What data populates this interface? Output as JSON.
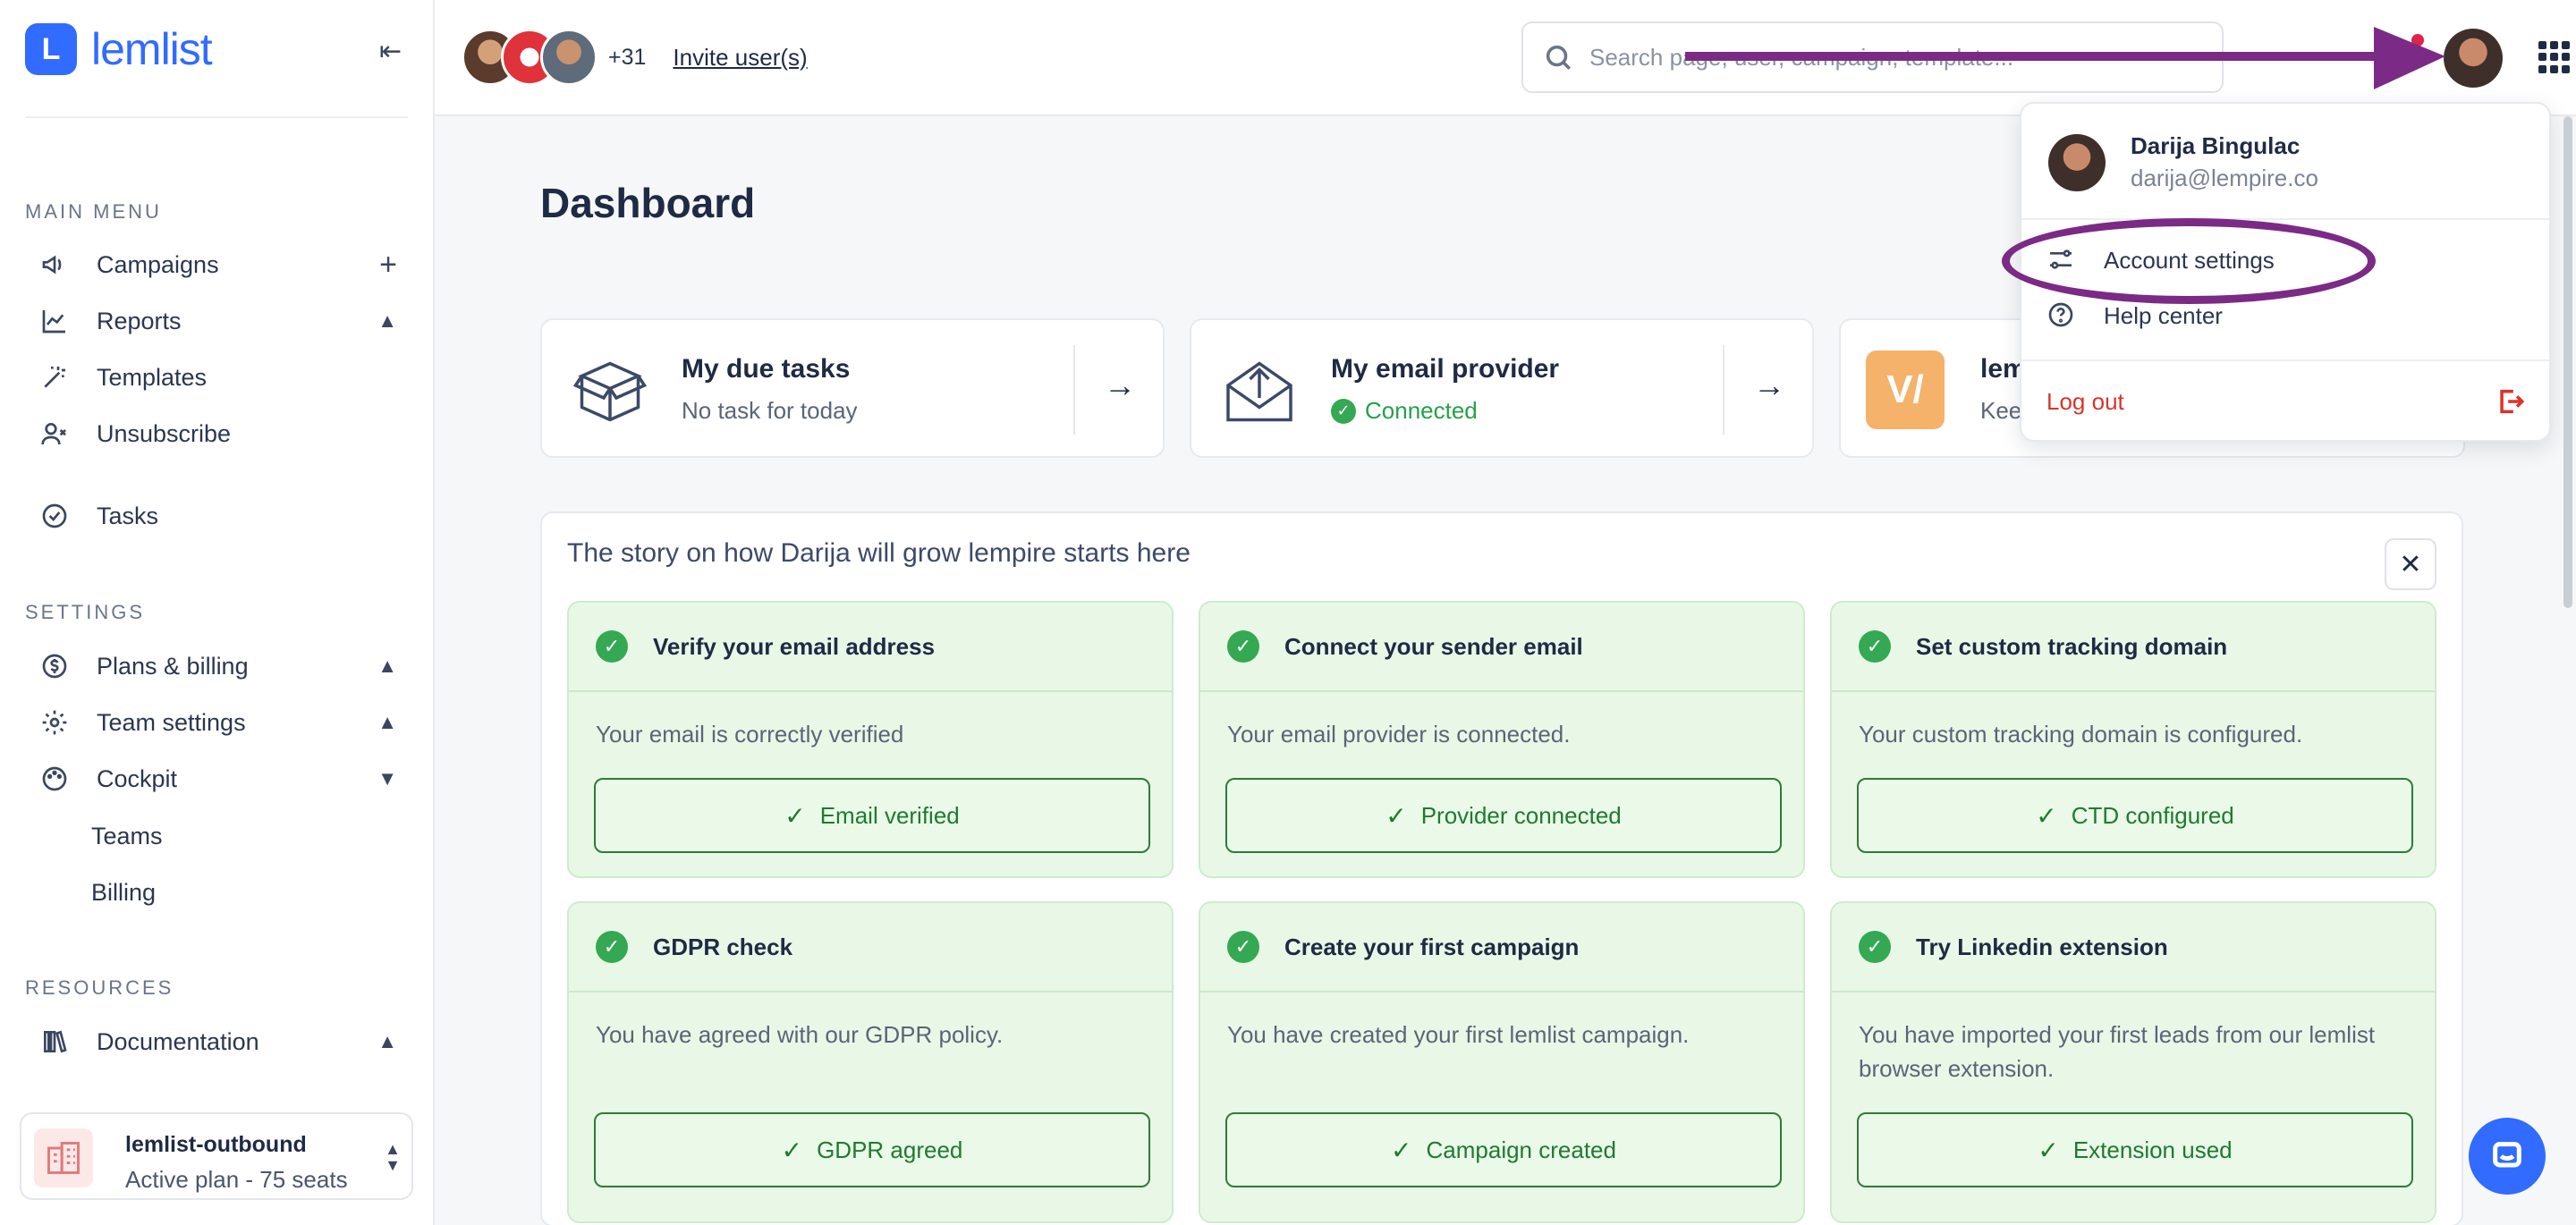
{
  "brand": {
    "name": "lemlist",
    "color": "#316bff"
  },
  "sidebar": {
    "collapse_label": "⇤",
    "sections": {
      "main_menu": "MAIN MENU",
      "settings": "SETTINGS",
      "resources": "RESOURCES"
    },
    "main_items": [
      {
        "label": "Campaigns",
        "icon": "megaphone-icon",
        "trail": "+"
      },
      {
        "label": "Reports",
        "icon": "chart-icon",
        "trail": "▲"
      },
      {
        "label": "Templates",
        "icon": "magic-wand-icon",
        "trail": ""
      },
      {
        "label": "Unsubscribe",
        "icon": "user-remove-icon",
        "trail": ""
      },
      {
        "label": "Tasks",
        "icon": "check-circle-icon",
        "trail": ""
      }
    ],
    "settings_items": [
      {
        "label": "Plans & billing",
        "icon": "dollar-icon",
        "trail": "▲"
      },
      {
        "label": "Team settings",
        "icon": "gear-icon",
        "trail": "▲"
      },
      {
        "label": "Cockpit",
        "icon": "palette-icon",
        "trail": "▼"
      }
    ],
    "cockpit_sub": [
      "Teams",
      "Billing"
    ],
    "resources_items": [
      {
        "label": "Documentation",
        "icon": "books-icon",
        "trail": "▲"
      }
    ],
    "workspace": {
      "name": "lemlist-outbound",
      "plan": "Active plan - 75 seats"
    }
  },
  "topbar": {
    "more_users": "+31",
    "invite": "Invite user(s)",
    "search_placeholder": "Search page, user, campaign, template..."
  },
  "main": {
    "title": "Dashboard",
    "cards": [
      {
        "title": "My due tasks",
        "sub": "No task for today"
      },
      {
        "title": "My email provider",
        "sub": "Connected"
      },
      {
        "title": "lemw",
        "sub": "Keep"
      }
    ],
    "story": {
      "title": "The story on how Darija will grow lempire starts here",
      "close": "✕",
      "steps": [
        {
          "title": "Verify your email address",
          "desc": "Your email is correctly verified",
          "button": "Email verified"
        },
        {
          "title": "Connect your sender email",
          "desc": "Your email provider is connected.",
          "button": "Provider connected"
        },
        {
          "title": "Set custom tracking domain",
          "desc": "Your custom tracking domain is configured.",
          "button": "CTD configured"
        },
        {
          "title": "GDPR check",
          "desc": "You have agreed with our GDPR policy.",
          "button": "GDPR agreed"
        },
        {
          "title": "Create your first campaign",
          "desc": "You have created your first lemlist campaign.",
          "button": "Campaign created"
        },
        {
          "title": "Try Linkedin extension",
          "desc": "You have imported your first leads from our lemlist browser extension.",
          "button": "Extension used"
        }
      ]
    }
  },
  "user_menu": {
    "name": "Darija Bingulac",
    "email": "darija@lempire.co",
    "items": [
      {
        "label": "Account settings",
        "icon": "sliders-icon"
      },
      {
        "label": "Help center",
        "icon": "question-circle-icon"
      }
    ],
    "logout": "Log out"
  },
  "colors": {
    "success": "#34a853",
    "danger": "#d9342b",
    "annotation": "#7b2a86"
  }
}
